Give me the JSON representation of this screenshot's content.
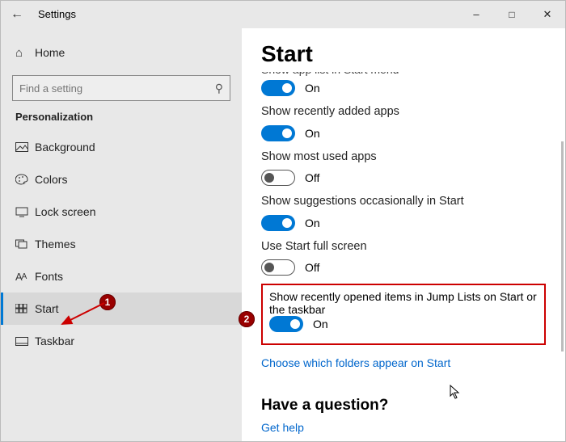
{
  "window": {
    "title": "Settings"
  },
  "sidebar": {
    "home": "Home",
    "search_placeholder": "Find a setting",
    "category": "Personalization",
    "items": [
      {
        "label": "Background"
      },
      {
        "label": "Colors"
      },
      {
        "label": "Lock screen"
      },
      {
        "label": "Themes"
      },
      {
        "label": "Fonts"
      },
      {
        "label": "Start"
      },
      {
        "label": "Taskbar"
      }
    ]
  },
  "main": {
    "heading": "Start",
    "cutoff_label": "Show app list in Start menu",
    "settings": [
      {
        "label": "",
        "state": "On",
        "on": true
      },
      {
        "label": "Show recently added apps",
        "state": "On",
        "on": true
      },
      {
        "label": "Show most used apps",
        "state": "Off",
        "on": false
      },
      {
        "label": "Show suggestions occasionally in Start",
        "state": "On",
        "on": true
      },
      {
        "label": "Use Start full screen",
        "state": "Off",
        "on": false
      },
      {
        "label": "Show recently opened items in Jump Lists on Start or the taskbar",
        "state": "On",
        "on": true
      }
    ],
    "folders_link": "Choose which folders appear on Start",
    "question_heading": "Have a question?",
    "help_link": "Get help"
  },
  "markers": {
    "one": "1",
    "two": "2"
  },
  "toggle_states": {
    "on": "On",
    "off": "Off"
  }
}
